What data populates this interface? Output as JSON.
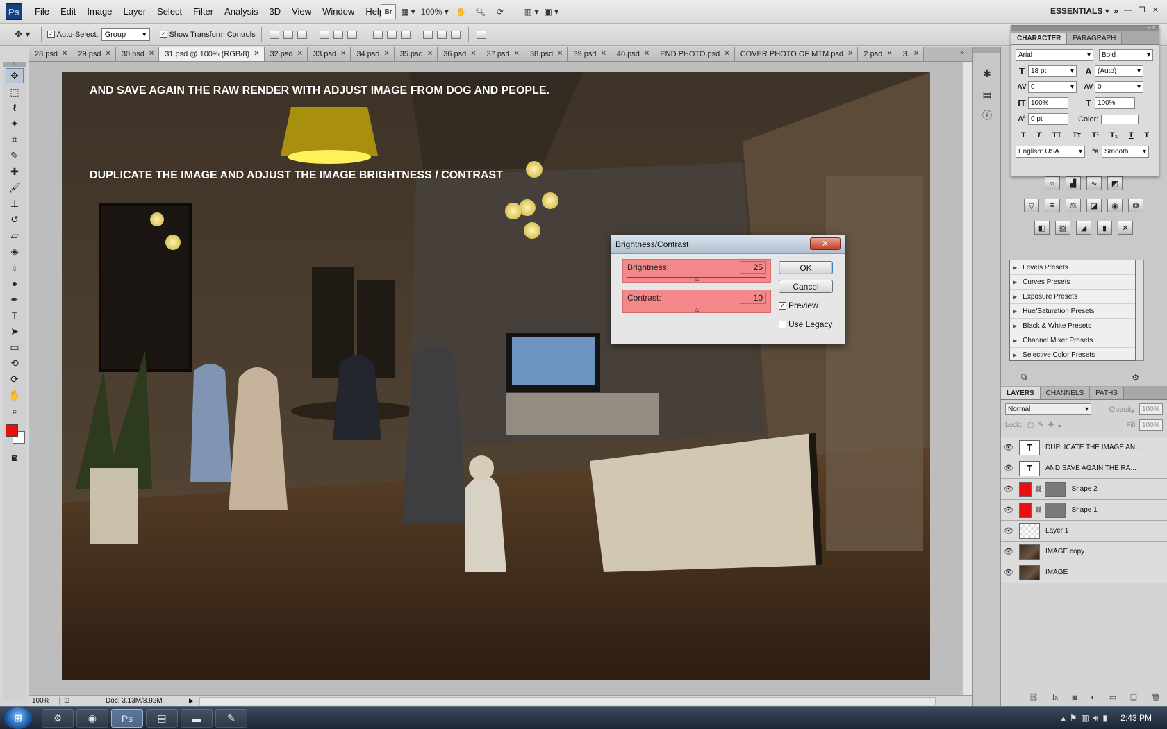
{
  "app": {
    "logo": "Ps",
    "workspace": "ESSENTIALS",
    "zoom_select": "100%",
    "bridge_label": "Br"
  },
  "menu": [
    "File",
    "Edit",
    "Image",
    "Layer",
    "Select",
    "Filter",
    "Analysis",
    "3D",
    "View",
    "Window",
    "Help"
  ],
  "options": {
    "auto_select_label": "Auto-Select:",
    "auto_select_value": "Group",
    "transform_label": "Show Transform Controls"
  },
  "tabs": [
    {
      "label": "28.psd"
    },
    {
      "label": "29.psd"
    },
    {
      "label": "30.psd"
    },
    {
      "label": "31.psd @ 100% (RGB/8)",
      "active": true
    },
    {
      "label": "32.psd"
    },
    {
      "label": "33.psd"
    },
    {
      "label": "34.psd"
    },
    {
      "label": "35.psd"
    },
    {
      "label": "36.psd"
    },
    {
      "label": "37.psd"
    },
    {
      "label": "38.psd"
    },
    {
      "label": "39.psd"
    },
    {
      "label": "40.psd"
    },
    {
      "label": "END PHOTO.psd"
    },
    {
      "label": "COVER PHOTO OF MTM.psd"
    },
    {
      "label": "2.psd"
    },
    {
      "label": "3."
    }
  ],
  "canvas": {
    "annotation_1": "AND SAVE AGAIN THE RAW RENDER WITH ADJUST IMAGE FROM DOG AND PEOPLE.",
    "annotation_2": "DUPLICATE THE IMAGE AND ADJUST THE IMAGE BRIGHTNESS / CONTRAST"
  },
  "dialog": {
    "title": "Brightness/Contrast",
    "brightness_label": "Brightness:",
    "brightness_value": "25",
    "brightness_level": 0.5,
    "contrast_label": "Contrast:",
    "contrast_value": "10",
    "contrast_level": 0.5,
    "ok": "OK",
    "cancel": "Cancel",
    "preview": "Preview",
    "preview_checked": true,
    "legacy": "Use Legacy",
    "legacy_checked": false
  },
  "character": {
    "tab_character": "CHARACTER",
    "tab_paragraph": "PARAGRAPH",
    "font": "Arial",
    "style": "Bold",
    "size": "18 pt",
    "leading": "(Auto)",
    "kerning": "0",
    "tracking": "0",
    "vscale": "100%",
    "hscale": "100%",
    "baseline": "0 pt",
    "color_label": "Color:",
    "language": "English: USA",
    "antialias": "Smooth"
  },
  "presets": [
    "Levels Presets",
    "Curves Presets",
    "Exposure Presets",
    "Hue/Saturation Presets",
    "Black & White Presets",
    "Channel Mixer Presets",
    "Selective Color Presets"
  ],
  "layers_panel": {
    "tabs": [
      "LAYERS",
      "CHANNELS",
      "PATHS"
    ],
    "blend_mode": "Normal",
    "opacity_label": "Opacity:",
    "opacity": "100%",
    "lock_label": "Lock:",
    "fill_label": "Fill:",
    "fill": "100%",
    "layers": [
      {
        "name": "DUPLICATE THE IMAGE AN...",
        "kind": "text"
      },
      {
        "name": "AND SAVE AGAIN THE RA...",
        "kind": "text"
      },
      {
        "name": "Shape 2",
        "kind": "shape"
      },
      {
        "name": "Shape 1",
        "kind": "shape"
      },
      {
        "name": "Layer 1",
        "kind": "empty"
      },
      {
        "name": "IMAGE copy",
        "kind": "image"
      },
      {
        "name": "IMAGE",
        "kind": "image"
      }
    ]
  },
  "status": {
    "zoom": "100%",
    "doc": "Doc: 3.13M/8.92M"
  },
  "taskbar": {
    "time": "2:43 PM"
  },
  "colors": {
    "foreground": "#e81010",
    "background": "#ffffff",
    "highlight": "#f2888a",
    "accent": "#3d7fbf"
  }
}
